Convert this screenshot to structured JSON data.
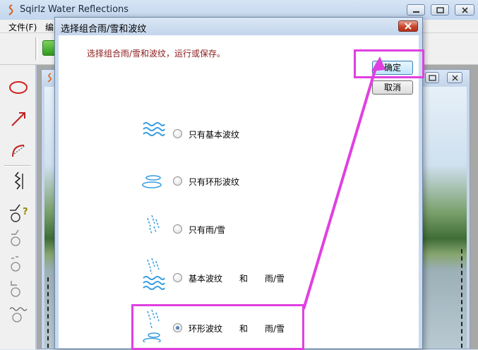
{
  "app": {
    "title": "Sqirlz Water Reflections",
    "menu": [
      "文件(F)",
      "编"
    ]
  },
  "dialog": {
    "title": "选择组合雨/雪和波纹",
    "prompt": "选择组合雨/雪和波纹，运行或保存。",
    "ok_label": "确定",
    "cancel_label": "取消",
    "options": [
      {
        "label": "只有基本波纹",
        "icon": "basic-ripple-icon",
        "selected": false
      },
      {
        "label": "只有环形波纹",
        "icon": "ring-ripple-icon",
        "selected": false
      },
      {
        "label": "只有雨/雪",
        "icon": "rain-snow-icon",
        "selected": false
      },
      {
        "label": "基本波纹　　和　　雨/雪",
        "icon": "basic-ripple-rain-icon",
        "selected": false
      },
      {
        "label": "环形波纹　　和　　雨/雪",
        "icon": "ring-ripple-rain-icon",
        "selected": true
      }
    ]
  },
  "colors": {
    "highlight": "#e040e0",
    "prompt_text": "#8b1a1a",
    "ripple_blue": "#3b9ee0",
    "close_button": "#c8452a"
  }
}
